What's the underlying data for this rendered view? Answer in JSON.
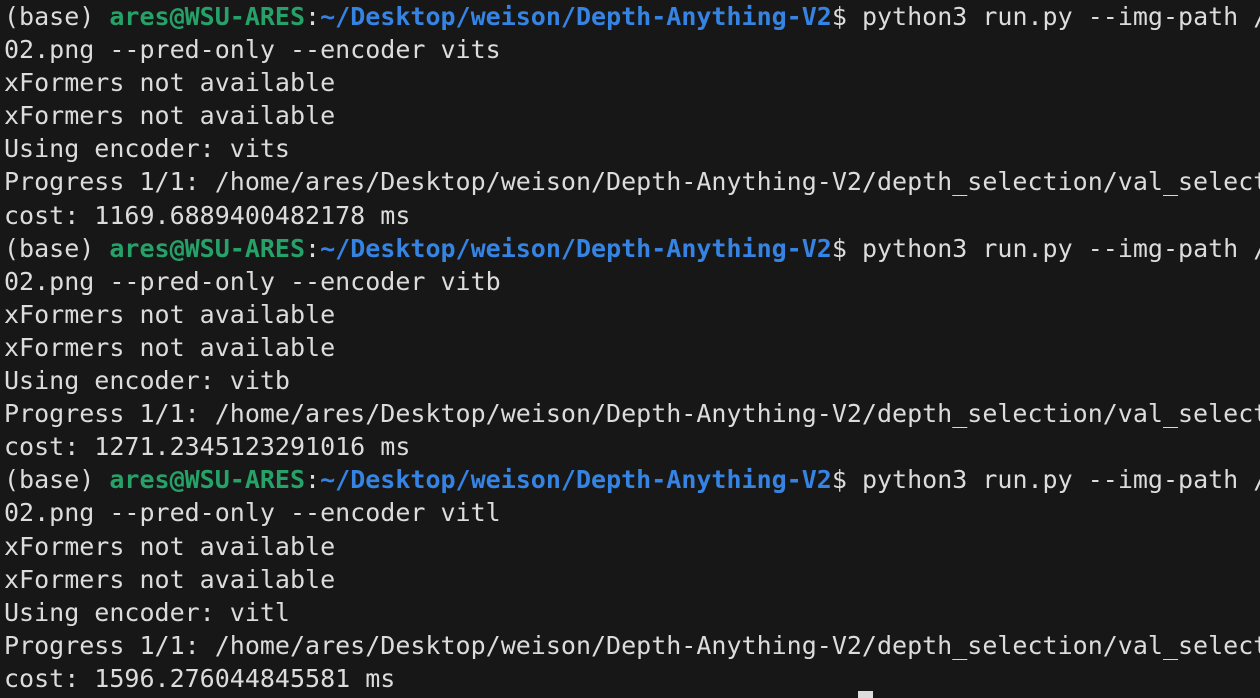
{
  "terminal": {
    "blocks": [
      {
        "prompt": {
          "env": "(base) ",
          "user_host": "ares@WSU-ARES",
          "sep": ":",
          "path": "~/Desktop/weison/Depth-Anything-V2",
          "cmd": "$ python3 run.py --img-path /"
        },
        "wrap": "02.png --pred-only --encoder vits",
        "out1": "xFormers not available",
        "out2": "xFormers not available",
        "encoder": "Using encoder: vits",
        "progress": "Progress 1/1: /home/ares/Desktop/weison/Depth-Anything-V2/depth_selection/val_select",
        "cost": "cost: 1169.6889400482178 ms"
      },
      {
        "prompt": {
          "env": "(base) ",
          "user_host": "ares@WSU-ARES",
          "sep": ":",
          "path": "~/Desktop/weison/Depth-Anything-V2",
          "cmd": "$ python3 run.py --img-path /"
        },
        "wrap": "02.png --pred-only --encoder vitb",
        "out1": "xFormers not available",
        "out2": "xFormers not available",
        "encoder": "Using encoder: vitb",
        "progress": "Progress 1/1: /home/ares/Desktop/weison/Depth-Anything-V2/depth_selection/val_select",
        "cost": "cost: 1271.2345123291016 ms"
      },
      {
        "prompt": {
          "env": "(base) ",
          "user_host": "ares@WSU-ARES",
          "sep": ":",
          "path": "~/Desktop/weison/Depth-Anything-V2",
          "cmd": "$ python3 run.py --img-path /"
        },
        "wrap": "02.png --pred-only --encoder vitl",
        "out1": "xFormers not available",
        "out2": "xFormers not available",
        "encoder": "Using encoder: vitl",
        "progress": "Progress 1/1: /home/ares/Desktop/weison/Depth-Anything-V2/depth_selection/val_select",
        "cost": "cost: 1596.276044845581 ms"
      }
    ],
    "colors": {
      "background": "#171717",
      "text": "#dcdcdc",
      "user_host": "#26a269",
      "path": "#3584e4"
    }
  }
}
